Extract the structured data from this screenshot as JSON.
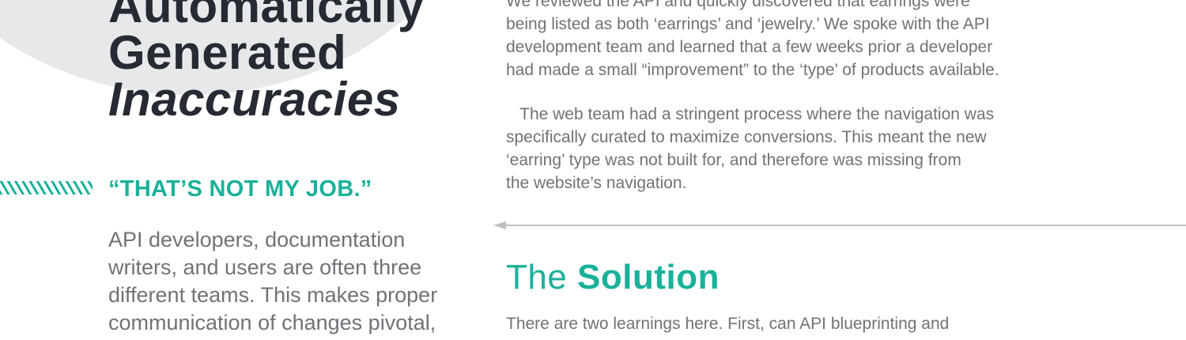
{
  "left": {
    "heading_lines": [
      "Automatically",
      "Generated",
      "Inaccuracies"
    ],
    "quote_title": "“THAT’S NOT MY JOB.”",
    "body_lines": [
      "API developers, documentation",
      "writers, and users are often three",
      "different teams. This makes proper",
      "communication of changes pivotal,"
    ]
  },
  "right": {
    "para1_lines": [
      "We reviewed the API and quickly discovered that earrings were",
      "being listed as both ‘earrings’ and ‘jewelry.’ We spoke with the API",
      "development team and learned that a few weeks prior a developer",
      "had made a small “improvement” to the ‘type’ of products available."
    ],
    "para2_lines": [
      "   The web team had a stringent process where the navigation was",
      "specifically curated to maximize conversions. This meant the new",
      "‘earring’ type was not built for, and therefore was missing from",
      "the website’s navigation."
    ],
    "solution_title_regular": "The ",
    "solution_title_bold": "Solution",
    "solution_body": "There are two learnings here. First, can API blueprinting and"
  },
  "colors": {
    "accent": "#1ab19a",
    "heading": "#252a33",
    "body": "#707277",
    "circle": "#e7e8ea",
    "divider": "#bdbec1"
  }
}
